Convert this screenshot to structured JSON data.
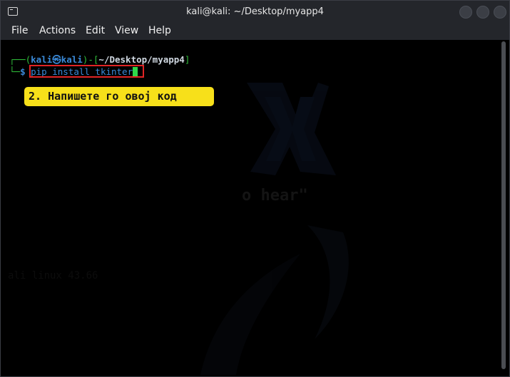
{
  "window": {
    "title": "kali@kali: ~/Desktop/myapp4"
  },
  "menu": {
    "items": [
      {
        "label": "File"
      },
      {
        "label": "Actions"
      },
      {
        "label": "Edit"
      },
      {
        "label": "View"
      },
      {
        "label": "Help"
      }
    ]
  },
  "terminal": {
    "prompt": {
      "corner_top": "┌──(",
      "user": "kali",
      "symbol": "㉿",
      "host": "kali",
      "close_paren": ")-[",
      "path": "~/Desktop/myapp4",
      "close_bracket": "]",
      "corner_bottom": "└─",
      "dollar": "$ "
    },
    "command": "pip install tkinter",
    "watermark_text": "o hear\"",
    "watermark_faint": "ali linux 43.66"
  },
  "annotation": {
    "text": "2. Напишете го овој код",
    "color": "#f7e01a"
  },
  "colors": {
    "highlight_border": "#e02424",
    "prompt_green": "#2fbf3a",
    "prompt_blue": "#3a8ad9"
  }
}
